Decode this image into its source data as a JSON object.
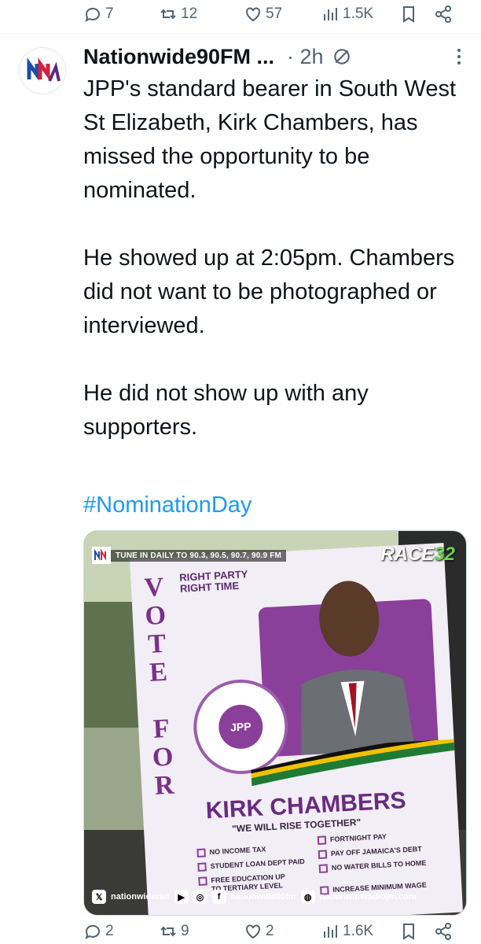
{
  "top_actions": {
    "replies": "7",
    "reposts": "12",
    "likes": "57",
    "views": "1.5K"
  },
  "tweet": {
    "author": "Nationwide90FM ...",
    "time": "· 2h",
    "text": "JPP's standard bearer in South West St Elizabeth, Kirk Chambers, has missed the opportunity to be nominated.\n\nHe showed up at 2:05pm. Chambers did not want to be photographed or interviewed.\n\nHe did not show up with any supporters.",
    "hashtag": "#NominationDay"
  },
  "media": {
    "tune_text": "TUNE IN DAILY TO 90.3, 90.5, 90.7, 90.9 FM",
    "race_badge": "RACE",
    "race_number": "32",
    "social_handle_x": "nationwiderad",
    "social_handle_fb": "nationwide90fm",
    "social_site": "nationwideradiojm.com",
    "flyer": {
      "vote_letters": "V\nO\nT\nE\n \nF\nO\nR",
      "right_party": "RIGHT PARTY\nRIGHT TIME",
      "seal_text": "JPP",
      "candidate_name": "KIRK CHAMBERS",
      "slogan": "\"WE WILL RISE TOGETHER\"",
      "platform_left": [
        "NO INCOME TAX",
        "STUDENT LOAN DEPT PAID",
        "FREE EDUCATION UP TO TERTIARY LEVEL"
      ],
      "platform_right": [
        "FORTNIGHT PAY",
        "PAY OFF JAMAICA'S DEBT",
        "NO WATER BILLS TO HOME",
        "INCREASE MINIMUM WAGE"
      ]
    }
  },
  "bottom_actions": {
    "replies": "2",
    "reposts": "9",
    "likes": "2",
    "views": "1.6K"
  },
  "colors": {
    "hashtag": "#1d9bf0",
    "muted": "#536471",
    "text": "#0f1419",
    "brand_purple": "#8a3f9a"
  },
  "icons": [
    "reply-icon",
    "repost-icon",
    "like-icon",
    "views-icon",
    "bookmark-icon",
    "share-icon",
    "grok-icon",
    "more-icon"
  ]
}
